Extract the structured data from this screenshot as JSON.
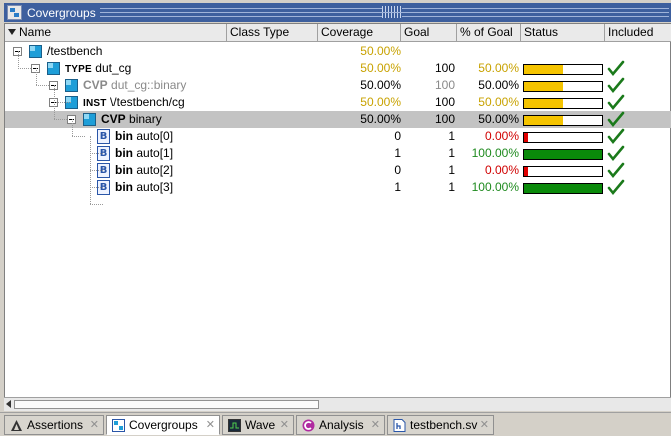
{
  "window": {
    "title": "Covergroups"
  },
  "columns": [
    "Name",
    "Class Type",
    "Coverage",
    "Goal",
    "% of Goal",
    "Status",
    "Included"
  ],
  "rows": [
    {
      "level": 0,
      "type": "cube",
      "kw": "",
      "name": "/testbench",
      "coverage": "50.00%",
      "goal": "",
      "pct": "",
      "status": null,
      "included": false,
      "cov_color": "yellow",
      "goal_color": "",
      "pct_color": "",
      "name_color": ""
    },
    {
      "level": 1,
      "type": "cube",
      "kw": "TYPE",
      "name": "dut_cg",
      "coverage": "50.00%",
      "goal": "100",
      "pct": "50.00%",
      "status": 0.5,
      "included": true,
      "cov_color": "yellow",
      "goal_color": "",
      "pct_color": "yellow",
      "name_color": ""
    },
    {
      "level": 2,
      "type": "cube",
      "kw": "CVP",
      "name": "dut_cg::binary",
      "coverage": "50.00%",
      "goal": "100",
      "pct": "50.00%",
      "status": 0.5,
      "included": true,
      "cov_color": "",
      "goal_color": "gray",
      "pct_color": "",
      "name_color": "gray"
    },
    {
      "level": 2,
      "type": "cube",
      "kw": "INST",
      "name": "\\/testbench/cg",
      "coverage": "50.00%",
      "goal": "100",
      "pct": "50.00%",
      "status": 0.5,
      "included": true,
      "cov_color": "yellow",
      "goal_color": "",
      "pct_color": "yellow",
      "name_color": ""
    },
    {
      "level": 3,
      "type": "cube",
      "kw": "CVP",
      "name": "binary",
      "coverage": "50.00%",
      "goal": "100",
      "pct": "50.00%",
      "status": 0.5,
      "included": true,
      "cov_color": "",
      "goal_color": "",
      "pct_color": "",
      "name_color": "",
      "selected": true
    },
    {
      "level": 4,
      "type": "bin",
      "kw": "bin",
      "name": "auto[0]",
      "coverage": "0",
      "goal": "1",
      "pct": "0.00%",
      "status": 0.0,
      "included": true,
      "cov_color": "",
      "goal_color": "",
      "pct_color": "red",
      "name_color": ""
    },
    {
      "level": 4,
      "type": "bin",
      "kw": "bin",
      "name": "auto[1]",
      "coverage": "1",
      "goal": "1",
      "pct": "100.00%",
      "status": 1.0,
      "included": true,
      "cov_color": "",
      "goal_color": "",
      "pct_color": "green",
      "name_color": ""
    },
    {
      "level": 4,
      "type": "bin",
      "kw": "bin",
      "name": "auto[2]",
      "coverage": "0",
      "goal": "1",
      "pct": "0.00%",
      "status": 0.0,
      "included": true,
      "cov_color": "",
      "goal_color": "",
      "pct_color": "red",
      "name_color": ""
    },
    {
      "level": 4,
      "type": "bin",
      "kw": "bin",
      "name": "auto[3]",
      "coverage": "1",
      "goal": "1",
      "pct": "100.00%",
      "status": 1.0,
      "included": true,
      "cov_color": "",
      "goal_color": "",
      "pct_color": "green",
      "name_color": ""
    }
  ],
  "tabs": [
    {
      "label": "Assertions",
      "icon": "assertion-icon",
      "active": false
    },
    {
      "label": "Covergroups",
      "icon": "covergroup-icon",
      "active": true
    },
    {
      "label": "Wave",
      "icon": "wave-icon",
      "active": false
    },
    {
      "label": "Analysis",
      "icon": "analysis-icon",
      "active": false
    },
    {
      "label": "testbench.sv",
      "icon": "source-file-icon",
      "active": false
    }
  ],
  "colors": {
    "title_bg": "#3d5f9e",
    "status_yellow": "#f5c400",
    "status_green": "#0a8a0a",
    "status_red": "#e00000",
    "check": "#1b7a1b",
    "selected_row": "#c3c3c3"
  }
}
